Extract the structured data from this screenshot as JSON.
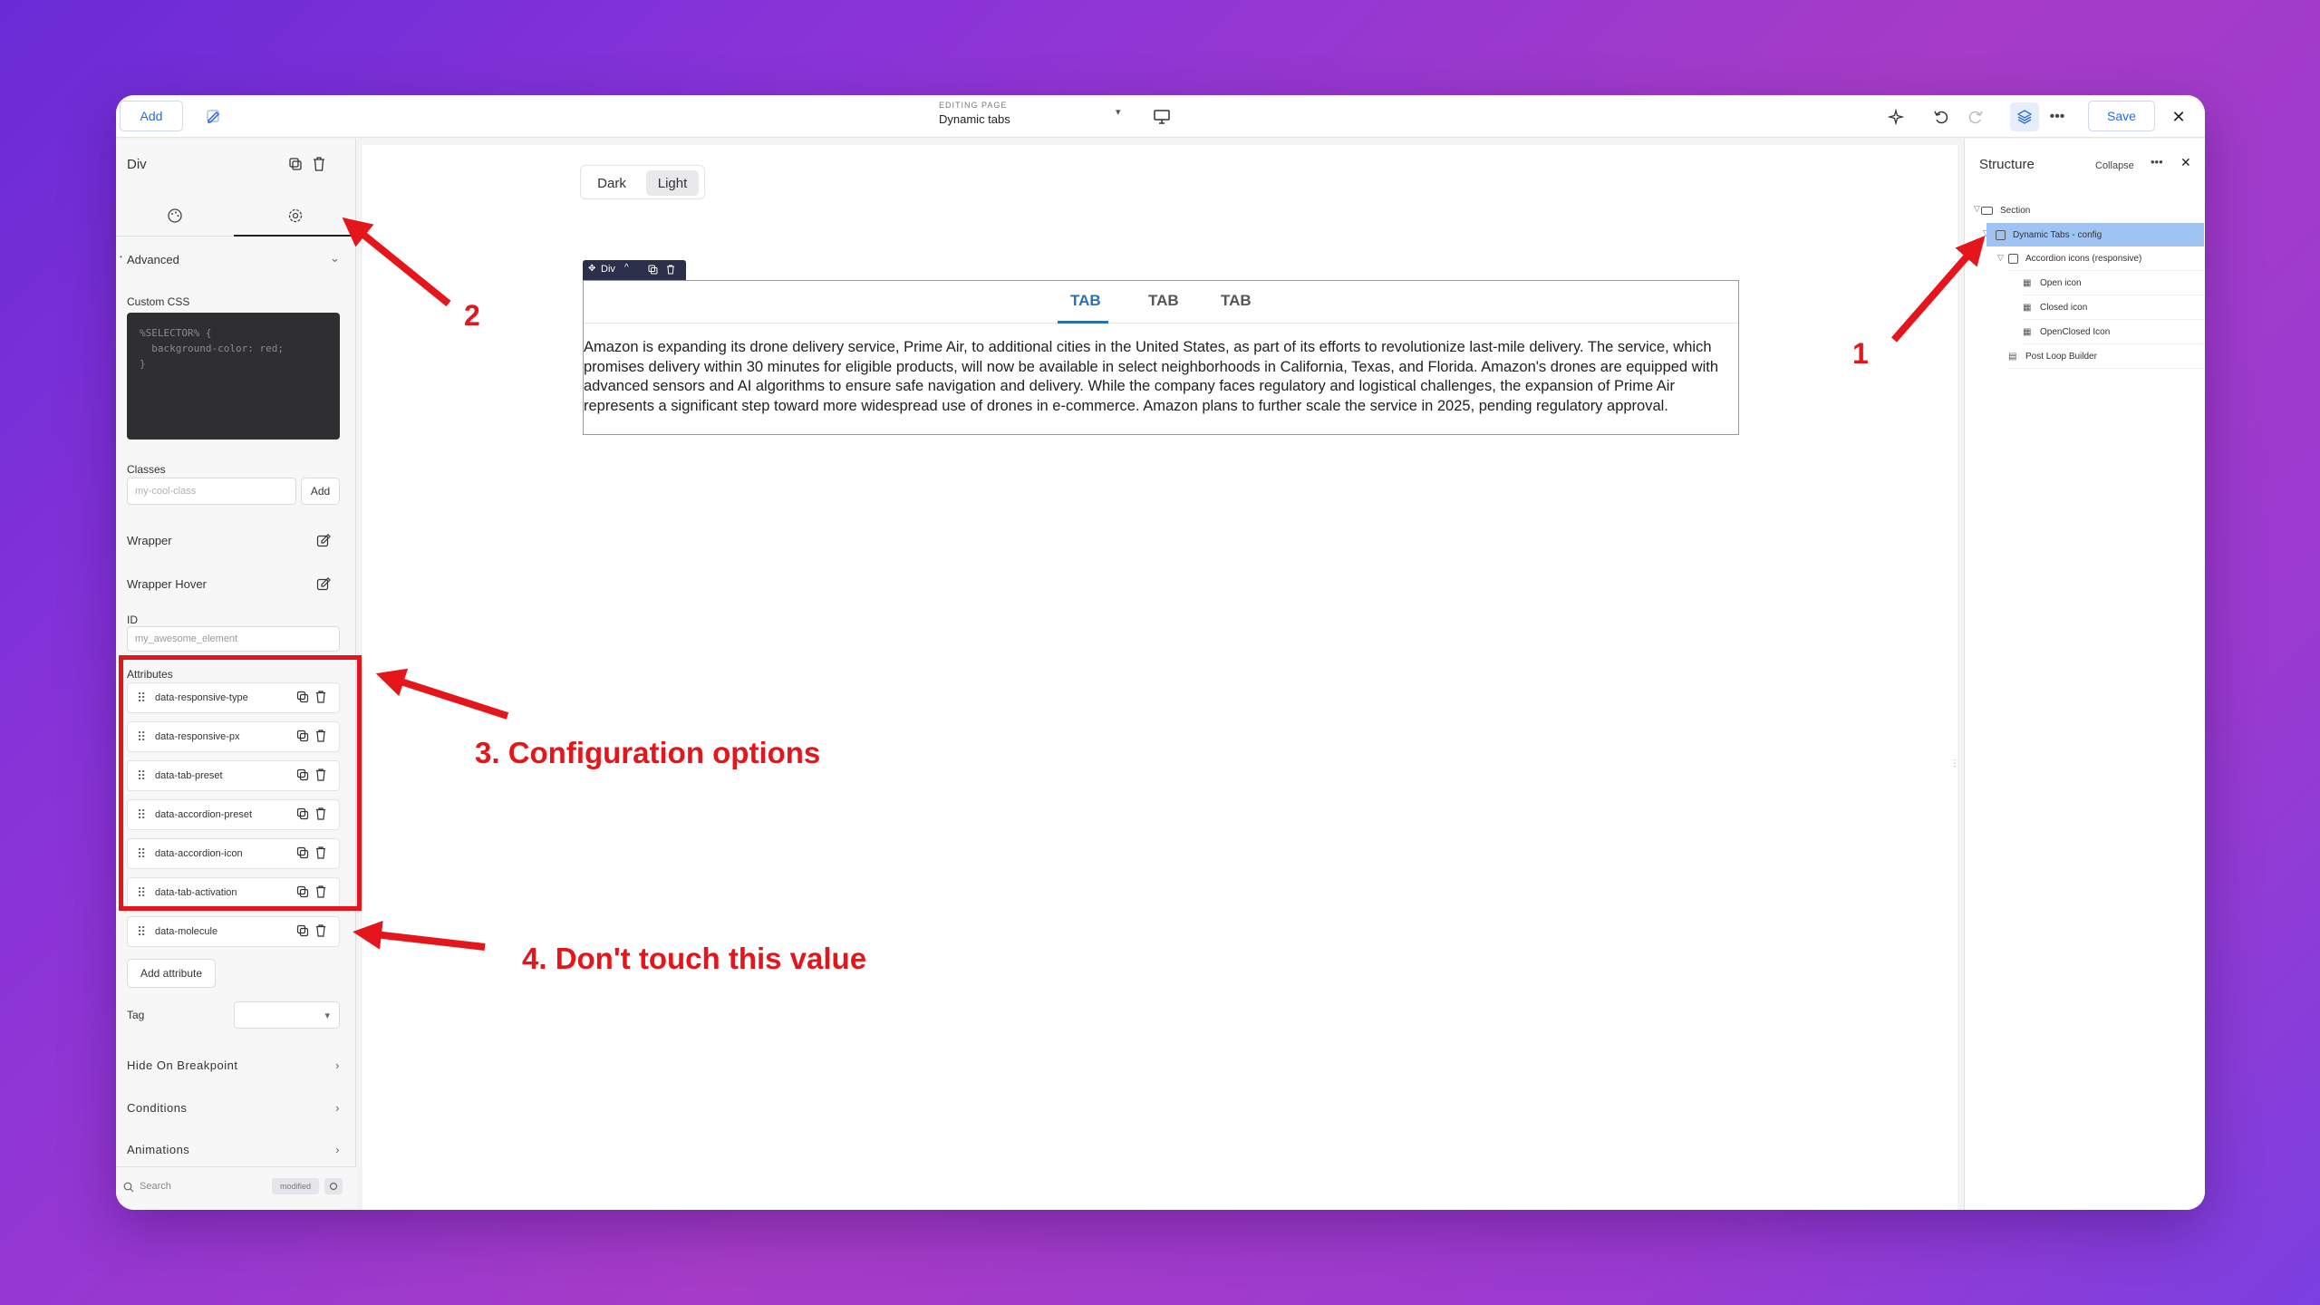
{
  "topbar": {
    "add_label": "Add",
    "editing_label": "EDITING PAGE",
    "editing_title": "Dynamic tabs",
    "save_label": "Save"
  },
  "left_panel": {
    "title": "Div",
    "advanced_label": "Advanced",
    "custom_css_label": "Custom CSS",
    "custom_css_value": "%SELECTOR% {\n  background-color: red;\n}",
    "classes_label": "Classes",
    "classes_placeholder": "my-cool-class",
    "classes_add_label": "Add",
    "wrapper_label": "Wrapper",
    "wrapper_hover_label": "Wrapper Hover",
    "id_label": "ID",
    "id_placeholder": "my_awesome_element",
    "attributes_label": "Attributes",
    "attributes": [
      {
        "name": "data-responsive-type"
      },
      {
        "name": "data-responsive-px"
      },
      {
        "name": "data-tab-preset"
      },
      {
        "name": "data-accordion-preset"
      },
      {
        "name": "data-accordion-icon"
      },
      {
        "name": "data-tab-activation"
      },
      {
        "name": "data-molecule"
      }
    ],
    "add_attribute_label": "Add attribute",
    "tag_label": "Tag",
    "hide_on_breakpoint_label": "Hide On Breakpoint",
    "conditions_label": "Conditions",
    "animations_label": "Animations",
    "search_placeholder": "Search",
    "modified_label": "modified"
  },
  "canvas": {
    "toggle_dark": "Dark",
    "toggle_light": "Light",
    "div_toolbar_label": "Div",
    "tabs": [
      {
        "label": "TAB"
      },
      {
        "label": "TAB"
      },
      {
        "label": "TAB"
      }
    ],
    "tab_content": "Amazon is expanding its drone delivery service, Prime Air, to additional cities in the United States, as part of its efforts to revolutionize last-mile delivery. The service, which promises delivery within 30 minutes for eligible products, will now be available in select neighborhoods in California, Texas, and Florida. Amazon's drones are equipped with advanced sensors and AI algorithms to ensure safe navigation and delivery. While the company faces regulatory and logistical challenges, the expansion of Prime Air represents a significant step toward more widespread use of drones in e-commerce. Amazon plans to further scale the service in 2025, pending regulatory approval."
  },
  "right_panel": {
    "title": "Structure",
    "collapse_label": "Collapse",
    "tree": [
      {
        "label": "Section"
      },
      {
        "label": "Dynamic Tabs - config"
      },
      {
        "label": "Accordion icons (responsive)"
      },
      {
        "label": "Open icon"
      },
      {
        "label": "Closed icon"
      },
      {
        "label": "OpenClosed Icon"
      },
      {
        "label": "Post Loop Builder"
      }
    ]
  },
  "annotations": {
    "one": "1",
    "two": "2",
    "three": "3. Configuration options",
    "four": "4. Don't touch this value"
  },
  "colors": {
    "accent": "#2a6fb0",
    "annotation_red": "#e4161b",
    "selected_tree": "#9fc4f3"
  }
}
